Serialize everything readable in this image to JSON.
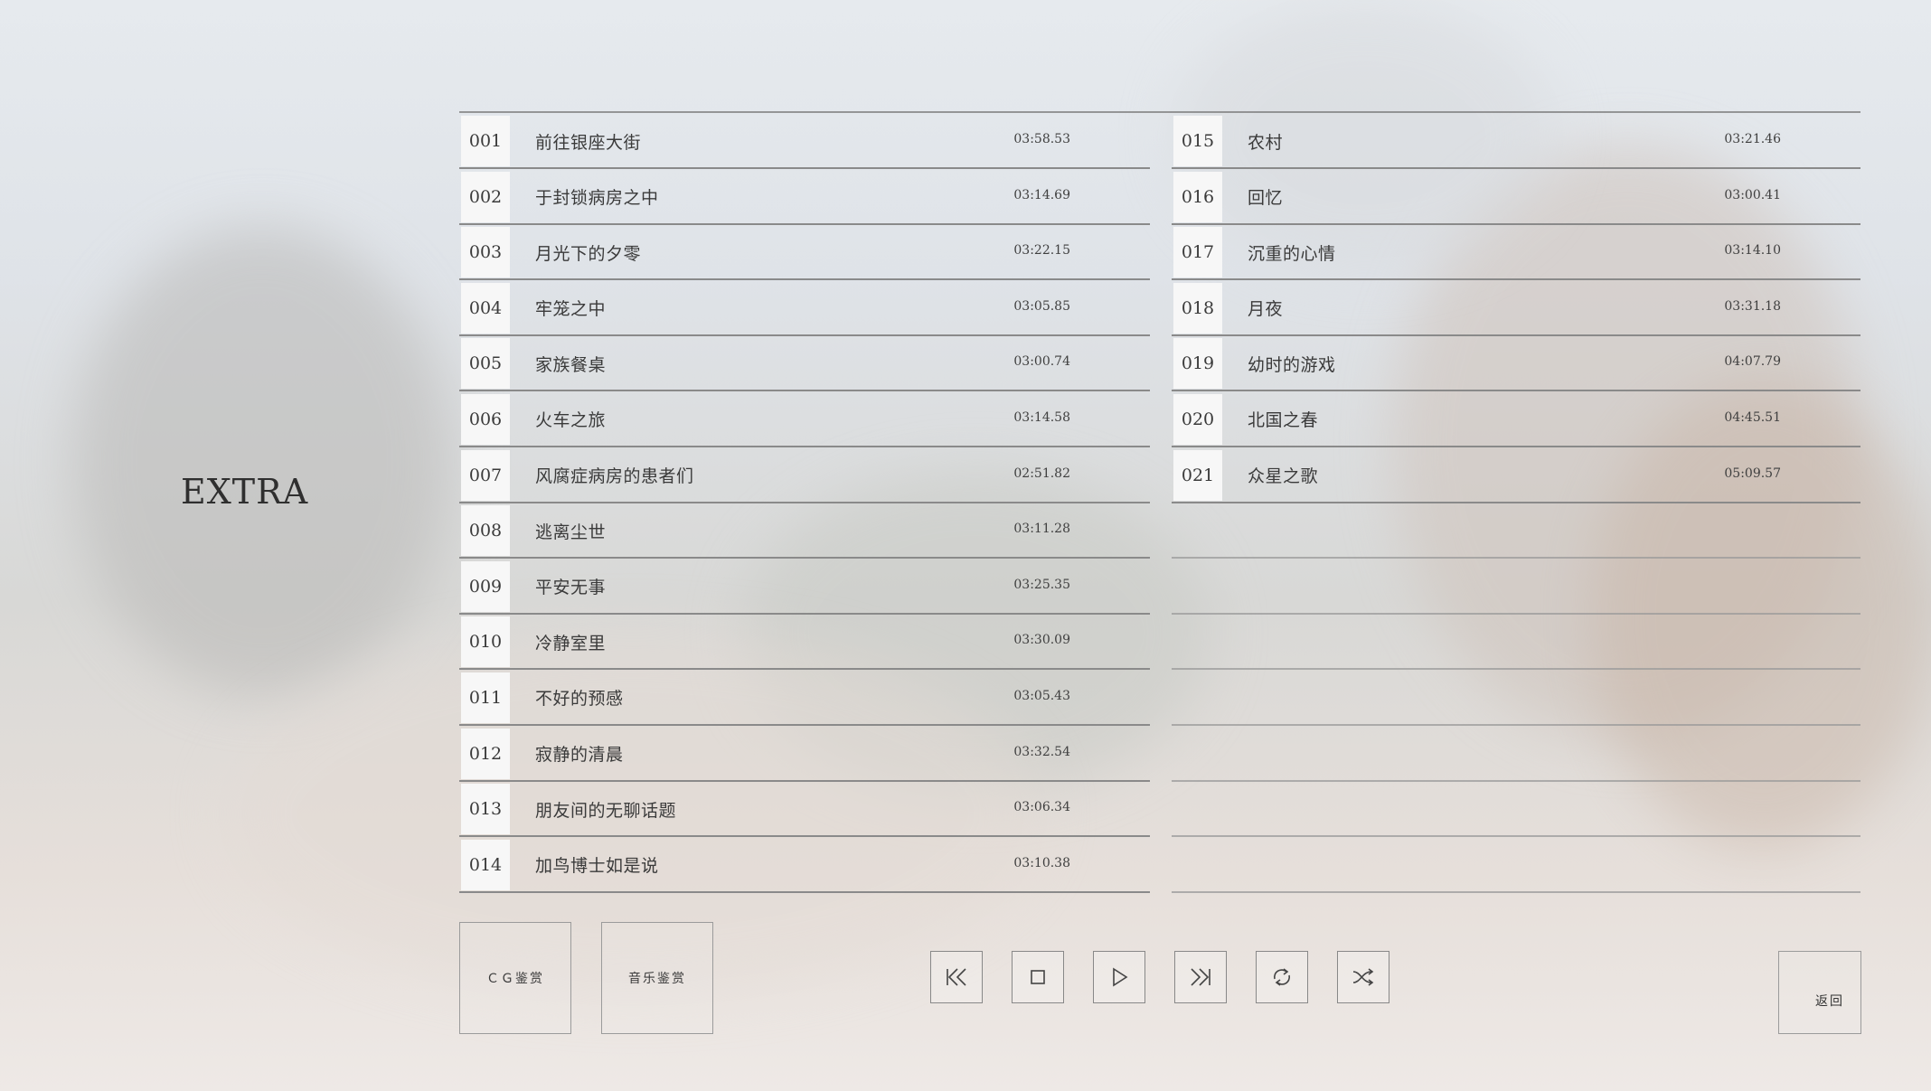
{
  "screen": {
    "title": "EXTRA"
  },
  "tracks_left": [
    {
      "num": "001",
      "title": "前往银座大街",
      "time": "03:58.53"
    },
    {
      "num": "002",
      "title": "于封锁病房之中",
      "time": "03:14.69"
    },
    {
      "num": "003",
      "title": "月光下的夕零",
      "time": "03:22.15"
    },
    {
      "num": "004",
      "title": "牢笼之中",
      "time": "03:05.85"
    },
    {
      "num": "005",
      "title": "家族餐桌",
      "time": "03:00.74"
    },
    {
      "num": "006",
      "title": "火车之旅",
      "time": "03:14.58"
    },
    {
      "num": "007",
      "title": "风腐症病房的患者们",
      "time": "02:51.82"
    },
    {
      "num": "008",
      "title": "逃离尘世",
      "time": "03:11.28"
    },
    {
      "num": "009",
      "title": "平安无事",
      "time": "03:25.35"
    },
    {
      "num": "010",
      "title": "冷静室里",
      "time": "03:30.09"
    },
    {
      "num": "011",
      "title": "不好的预感",
      "time": "03:05.43"
    },
    {
      "num": "012",
      "title": "寂静的清晨",
      "time": "03:32.54"
    },
    {
      "num": "013",
      "title": "朋友间的无聊话题",
      "time": "03:06.34"
    },
    {
      "num": "014",
      "title": "加鸟博士如是说",
      "time": "03:10.38"
    }
  ],
  "tracks_right": [
    {
      "num": "015",
      "title": "农村",
      "time": "03:21.46"
    },
    {
      "num": "016",
      "title": "回忆",
      "time": "03:00.41"
    },
    {
      "num": "017",
      "title": "沉重的心情",
      "time": "03:14.10"
    },
    {
      "num": "018",
      "title": "月夜",
      "time": "03:31.18"
    },
    {
      "num": "019",
      "title": "幼时的游戏",
      "time": "04:07.79"
    },
    {
      "num": "020",
      "title": "北国之春",
      "time": "04:45.51"
    },
    {
      "num": "021",
      "title": "众星之歌",
      "time": "05:09.57"
    }
  ],
  "mode_buttons": {
    "cg_label": "ＣＧ鉴赏",
    "music_label": "音乐鉴赏"
  },
  "controls": {
    "prev_icon": "skip-back-icon",
    "stop_icon": "stop-icon",
    "play_icon": "play-icon",
    "next_icon": "skip-forward-icon",
    "repeat_icon": "repeat-icon",
    "shuffle_icon": "shuffle-icon"
  },
  "back_label": "返回"
}
